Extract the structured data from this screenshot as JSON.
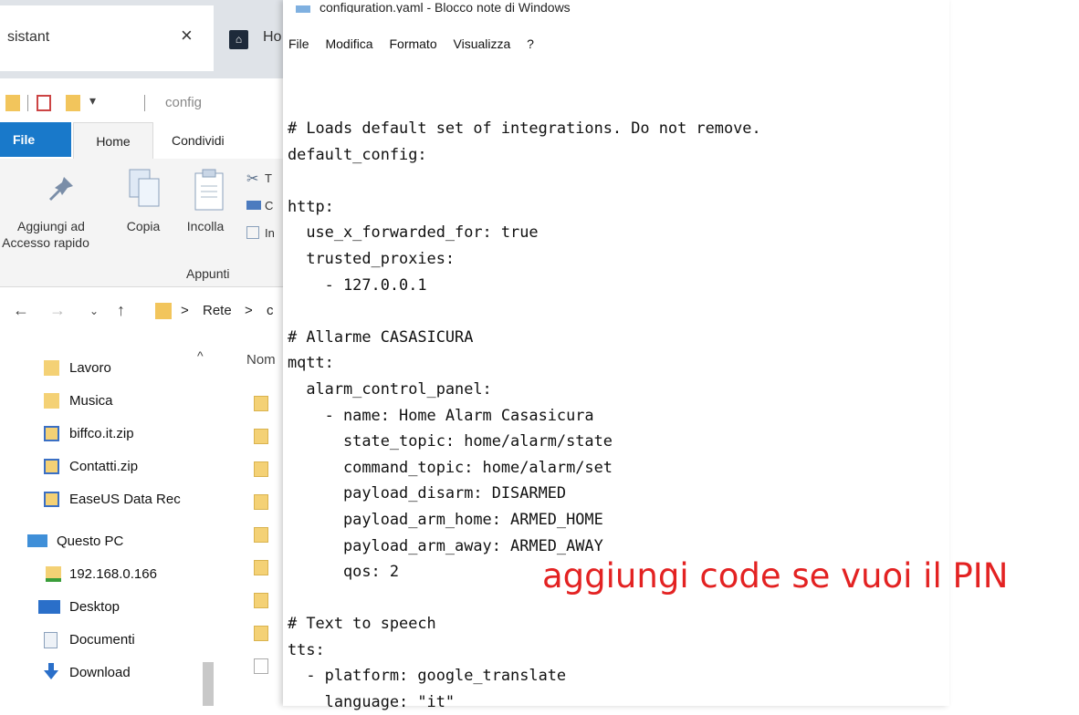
{
  "browser": {
    "tab1_title": "sistant",
    "tab1_close": "×",
    "tab2_icon": "home-assistant-favicon",
    "tab2_title": "Ho"
  },
  "explorer": {
    "address_title": "config",
    "ribbon_tabs": {
      "file": "File",
      "home": "Home",
      "share": "Condividi"
    },
    "ribbon_buttons": {
      "pin_line1": "Aggiungi ad",
      "pin_line2": "Accesso rapido",
      "copy": "Copia",
      "paste": "Incolla",
      "cut_prefix": "T",
      "copypath_prefix": "C",
      "shortcut_prefix": "In"
    },
    "ribbon_group": "Appunti",
    "breadcrumb": {
      "root": "Rete",
      "sep": ">",
      "next": "c"
    },
    "sidebar": [
      {
        "label": "Lavoro",
        "icon": "folder-icon"
      },
      {
        "label": "Musica",
        "icon": "folder-icon"
      },
      {
        "label": "biffco.it.zip",
        "icon": "zip-icon"
      },
      {
        "label": "Contatti.zip",
        "icon": "zip-icon"
      },
      {
        "label": "EaseUS Data Rec",
        "icon": "zip-icon"
      },
      {
        "label": "Questo PC",
        "icon": "computer-icon"
      },
      {
        "label": "192.168.0.166",
        "icon": "network-drive-icon"
      },
      {
        "label": "Desktop",
        "icon": "desktop-icon"
      },
      {
        "label": "Documenti",
        "icon": "documents-icon"
      },
      {
        "label": "Download",
        "icon": "download-icon"
      }
    ],
    "filelist_header": "Nom"
  },
  "notepad": {
    "title": "configuration.yaml - Blocco note di Windows",
    "menu": [
      "File",
      "Modifica",
      "Formato",
      "Visualizza",
      "?"
    ],
    "content": "# Loads default set of integrations. Do not remove.\ndefault_config:\n\nhttp:\n  use_x_forwarded_for: true\n  trusted_proxies:\n    - 127.0.0.1\n\n# Allarme CASASICURA\nmqtt:\n  alarm_control_panel:\n    - name: Home Alarm Casasicura\n      state_topic: home/alarm/state\n      command_topic: home/alarm/set\n      payload_disarm: DISARMED\n      payload_arm_home: ARMED_HOME\n      payload_arm_away: ARMED_AWAY\n      qos: 2\n\n# Text to speech\ntts:\n  - platform: google_translate\n    language: \"it\""
  },
  "annotation": {
    "text": "aggiungi code se vuoi il PIN",
    "color": "#e32222"
  }
}
